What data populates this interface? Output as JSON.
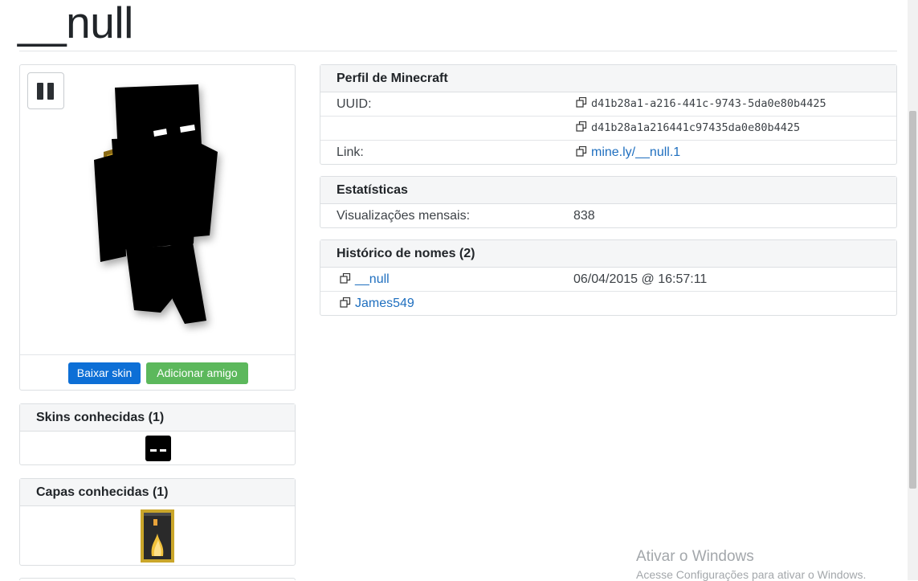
{
  "page": {
    "title": "__null"
  },
  "skin_viewer": {
    "download_label": "Baixar skin",
    "add_friend_label": "Adicionar amigo"
  },
  "skins_card": {
    "title": "Skins conhecidas (1)"
  },
  "capes_card": {
    "title": "Capas conhecidas (1)"
  },
  "profile": {
    "title": "Perfil de Minecraft",
    "uuid_label": "UUID:",
    "uuid": "d41b28a1-a216-441c-9743-5da0e80b4425",
    "uuid_plain": "d41b28a1a216441c97435da0e80b4425",
    "link_label": "Link:",
    "link": "mine.ly/__null.1"
  },
  "stats": {
    "title": "Estatísticas",
    "monthly_views_label": "Visualizações mensais:",
    "monthly_views": "838"
  },
  "name_history": {
    "title": "Histórico de nomes (2)",
    "names": [
      {
        "name": "__null",
        "date": "06/04/2015 @ 16:57:11"
      },
      {
        "name": "James549",
        "date": ""
      }
    ]
  },
  "watermark": {
    "line1": "Ativar o Windows",
    "line2": "Acesse Configurações para ativar o Windows."
  },
  "colors": {
    "download_button": "#0d6fd6",
    "add_friend_button": "#5cb85c",
    "link": "#1f6fbf",
    "card_header_bg": "#f5f6f7"
  },
  "icons": {
    "pause": "pause-icon",
    "copy": "copy-icon"
  }
}
